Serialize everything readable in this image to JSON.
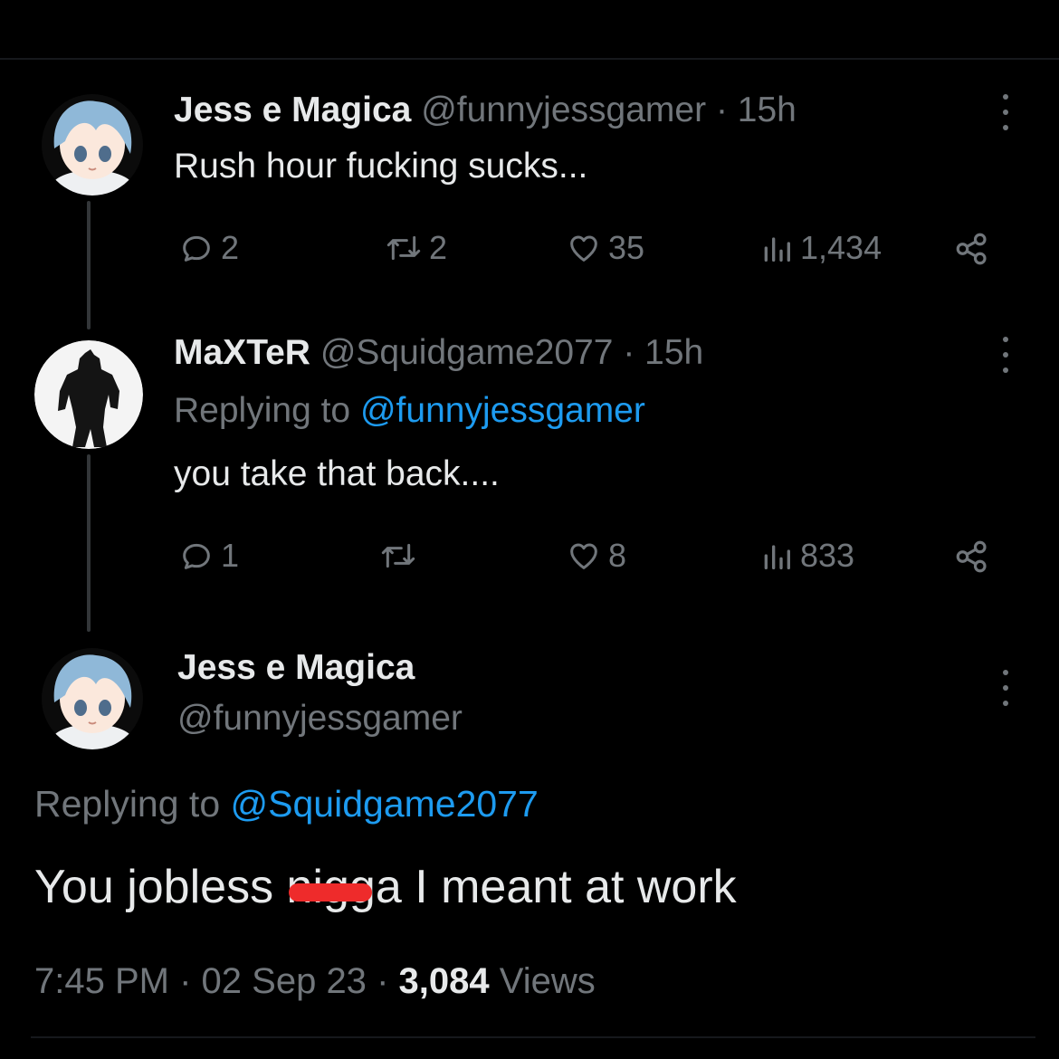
{
  "tweets": [
    {
      "author_name": "Jess e Magica",
      "handle": "@funnyjessgamer",
      "separator": "·",
      "time": "15h",
      "text": "Rush hour fucking sucks...",
      "stats": {
        "replies": "2",
        "retweets": "2",
        "likes": "35",
        "views": "1,434"
      }
    },
    {
      "author_name": "MaXTeR",
      "handle": "@Squidgame2077",
      "separator": "·",
      "time": "15h",
      "replying_label": "Replying to",
      "replying_to": "@funnyjessgamer",
      "text": "you take that back....",
      "stats": {
        "replies": "1",
        "retweets": "",
        "likes": "8",
        "views": "833"
      }
    }
  ],
  "main_tweet": {
    "author_name": "Jess e Magica",
    "handle": "@funnyjessgamer",
    "replying_label": "Replying to",
    "replying_to": "@Squidgame2077",
    "text_before": "You jobless ",
    "text_censored": "nigga",
    "text_after": " I meant at work",
    "time": "7:45 PM",
    "separator": "·",
    "date": "02 Sep 23",
    "views_count": "3,084",
    "views_label": "Views"
  },
  "colors": {
    "background": "#000000",
    "text_primary": "#e7e9ea",
    "text_secondary": "#71767b",
    "link": "#1d9bf0",
    "censor": "#ee2b2b"
  },
  "icons": [
    "reply-icon",
    "retweet-icon",
    "like-icon",
    "views-icon",
    "share-icon",
    "more-icon"
  ]
}
